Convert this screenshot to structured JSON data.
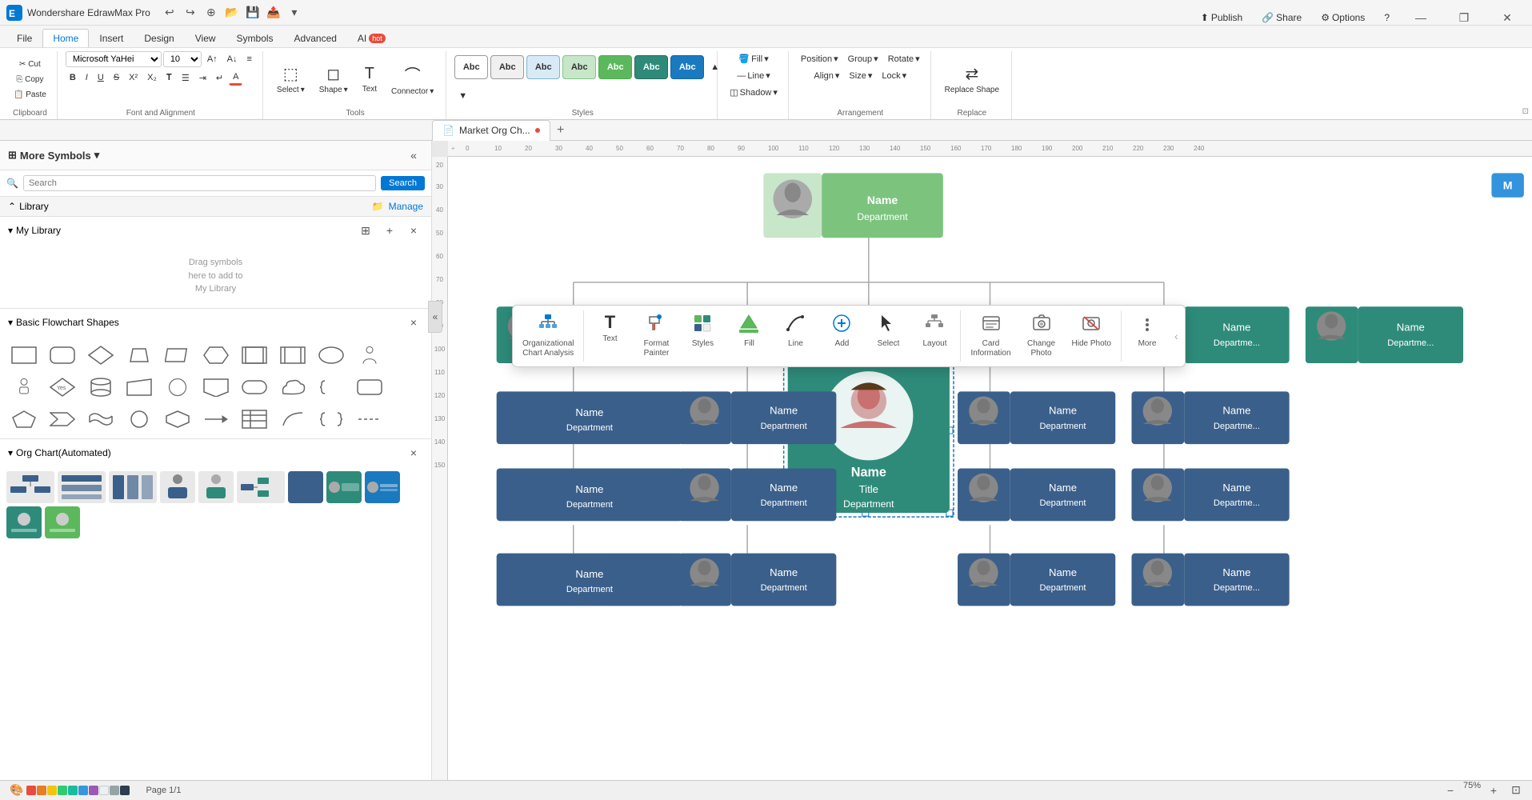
{
  "app": {
    "name": "Wondershare EdrawMax",
    "version": "Pro",
    "title_bar_label": "Wondershare EdrawMax Pro"
  },
  "title_bar": {
    "minimize": "—",
    "restore": "❐",
    "close": "✕"
  },
  "quick_toolbar": {
    "undo": "↩",
    "redo": "↪",
    "new": "+",
    "open": "📂",
    "save": "💾",
    "export": "📤",
    "more": "▾"
  },
  "ribbon_tabs": [
    {
      "id": "file",
      "label": "File"
    },
    {
      "id": "home",
      "label": "Home",
      "active": true
    },
    {
      "id": "insert",
      "label": "Insert"
    },
    {
      "id": "design",
      "label": "Design"
    },
    {
      "id": "view",
      "label": "View"
    },
    {
      "id": "symbols",
      "label": "Symbols"
    },
    {
      "id": "advanced",
      "label": "Advanced"
    },
    {
      "id": "ai",
      "label": "AI",
      "badge": "hot"
    }
  ],
  "top_right": {
    "publish": "Publish",
    "share": "Share",
    "options": "Options",
    "help": "?"
  },
  "ribbon": {
    "clipboard": {
      "label": "Clipboard",
      "cut": "✂",
      "copy": "⎘",
      "paste": "📋",
      "paste_special": "▾"
    },
    "font": {
      "label": "Font and Alignment",
      "name": "Microsoft YaHei",
      "size": "10",
      "bold": "B",
      "italic": "I",
      "underline": "U",
      "strikethrough": "S",
      "superscript": "X²",
      "subscript": "X₂",
      "grow": "A↑",
      "shrink": "A↓",
      "align": "≡",
      "list": "☰",
      "indent": "⇥",
      "color": "A"
    },
    "tools": {
      "label": "Tools",
      "select_label": "Select",
      "shape_label": "Shape",
      "text_label": "Text",
      "connector_label": "Connector"
    },
    "styles": {
      "label": "Styles",
      "swatches": [
        {
          "color": "#fff",
          "border": "#999",
          "text_color": "#333"
        },
        {
          "color": "#f0f0f0",
          "border": "#999",
          "text_color": "#333"
        },
        {
          "color": "#d9eaf7",
          "border": "#7fb3d3",
          "text_color": "#333"
        },
        {
          "color": "#c8e6c9",
          "border": "#81c784",
          "text_color": "#333"
        },
        {
          "color": "#5cb85c",
          "border": "#4cae4c",
          "text_color": "#fff"
        },
        {
          "color": "#2e8b7a",
          "border": "#276b5e",
          "text_color": "#fff"
        },
        {
          "color": "#1a7abf",
          "border": "#1565a0",
          "text_color": "#fff"
        }
      ]
    },
    "fill": {
      "label": "Fill",
      "line": "Line",
      "shadow": "Shadow"
    },
    "arrangement": {
      "label": "Arrangement",
      "position": "Position",
      "group": "Group",
      "rotate": "Rotate",
      "align": "Align",
      "size": "Size",
      "lock": "Lock"
    },
    "replace": {
      "label": "Replace",
      "replace_shape": "Replace Shape"
    }
  },
  "sidebar": {
    "title": "More Symbols",
    "collapse": "«",
    "search_placeholder": "Search",
    "search_btn": "Search",
    "library_label": "Library",
    "manage_label": "Manage",
    "my_library_label": "My Library",
    "my_library_placeholder": "Drag symbols\nhere to add to\nMy Library",
    "basic_flowchart_label": "Basic Flowchart Shapes",
    "org_chart_label": "Org Chart(Automated)",
    "my_library_actions": {
      "add_group": "⊞",
      "add": "+",
      "close": "×"
    },
    "basic_close": "×",
    "org_close": "×"
  },
  "tab_bar": {
    "doc_tab": "Market Org Ch...",
    "dot_color": "#e74c3c",
    "new_tab": "+"
  },
  "float_toolbar": {
    "org_chart_analysis": "Organizational\nChart Analysis",
    "text": "Text",
    "format_painter": "Format\nPainter",
    "styles": "Styles",
    "fill": "Fill",
    "line": "Line",
    "add": "Add",
    "select": "Select",
    "layout": "Layout",
    "card_information": "Card\nInformation",
    "change_photo": "Change\nPhoto",
    "hide_photo": "Hide Photo",
    "more": "More"
  },
  "canvas": {
    "zoom_level": "75%",
    "page_label": "Page 1"
  },
  "org_nodes": {
    "top": {
      "name": "Name",
      "dept": "Department",
      "type": "green_light"
    },
    "mid_left": {
      "name": "Name",
      "dept": "Department",
      "type": "teal"
    },
    "mid_right": {
      "name": "Name",
      "dept": "Department",
      "type": "teal"
    },
    "center_selected": {
      "name": "Name",
      "title": "Title",
      "dept": "Department",
      "type": "teal_selected"
    },
    "bottom_rows": [
      {
        "name": "Name",
        "dept": "Department"
      },
      {
        "name": "Name",
        "dept": "Department"
      },
      {
        "name": "Name",
        "dept": "Department"
      },
      {
        "name": "Name",
        "dept": "Department"
      },
      {
        "name": "Name",
        "dept": "Department"
      },
      {
        "name": "Name",
        "dept": "Department"
      },
      {
        "name": "Name",
        "dept": "Department"
      },
      {
        "name": "Name",
        "dept": "Department"
      }
    ]
  },
  "ruler": {
    "h_ticks": [
      "0",
      "10",
      "20",
      "30",
      "40",
      "50",
      "60",
      "70",
      "80",
      "90",
      "100",
      "110",
      "120",
      "130",
      "140",
      "150",
      "160",
      "170",
      "180",
      "190",
      "200",
      "210",
      "220",
      "230",
      "240"
    ],
    "v_ticks": [
      "20",
      "30",
      "40",
      "50",
      "60",
      "70",
      "80",
      "90",
      "100",
      "110",
      "120",
      "130",
      "140",
      "150"
    ]
  },
  "status_bar": {
    "page": "Page 1/1",
    "zoom_out": "−",
    "zoom_in": "+",
    "zoom": "75%",
    "fit": "⊡"
  },
  "colors": {
    "accent": "#0078d4",
    "green_light": "#5cb85c",
    "teal": "#2e8b7a",
    "teal_dark": "#276b5e",
    "selected_border": "#1a7abf",
    "node_blue": "#3a5f8a"
  }
}
